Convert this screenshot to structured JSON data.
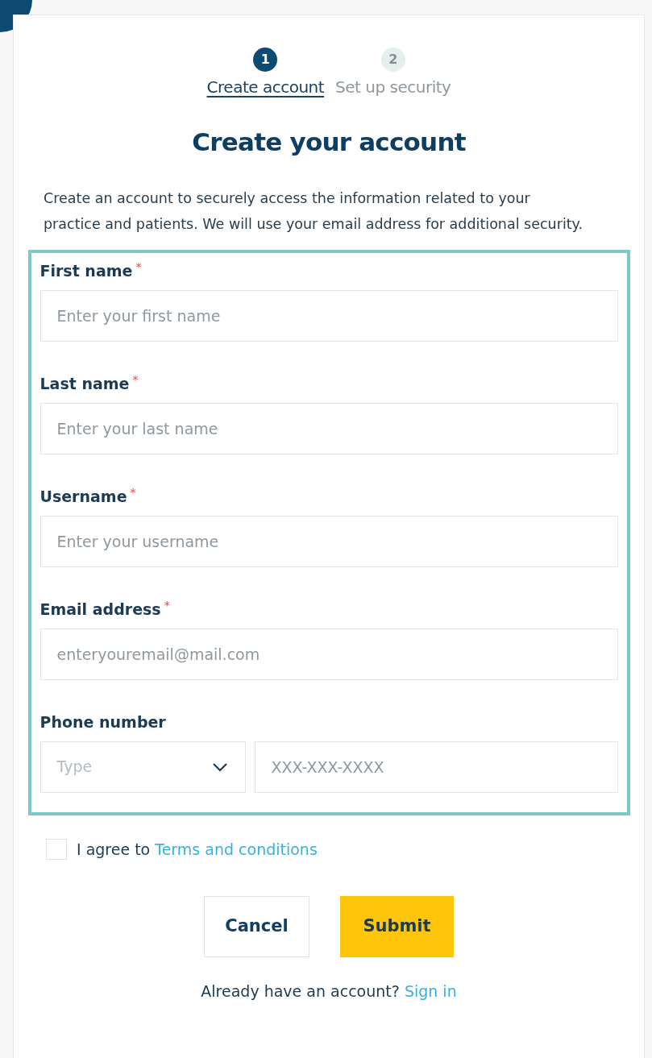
{
  "steps": [
    {
      "number": "1",
      "label": "Create account",
      "selected": true
    },
    {
      "number": "2",
      "label": "Set up security",
      "selected": false
    }
  ],
  "title": "Create your account",
  "intro": "Create an account to securely access the information related to your practice and patients.  We will use your email address for additional security.",
  "fields": [
    {
      "kind": "text",
      "label": "First name",
      "required": true,
      "placeholder": "Enter your first name"
    },
    {
      "kind": "text",
      "label": "Last name",
      "required": true,
      "placeholder": "Enter your last name"
    },
    {
      "kind": "text",
      "label": "Username",
      "required": true,
      "placeholder": "Enter your username"
    },
    {
      "kind": "text",
      "label": "Email address",
      "required": true,
      "placeholder": "enteryouremail@mail.com"
    },
    {
      "kind": "phone",
      "label": "Phone number",
      "required": false,
      "type_placeholder": "Type",
      "placeholder": "XXX-XXX-XXXX"
    }
  ],
  "required_mark": "*",
  "agree": {
    "checked": false,
    "text": "I agree to",
    "link": "Terms and conditions"
  },
  "buttons": {
    "cancel": "Cancel",
    "submit": "Submit"
  },
  "signin": {
    "text": "Already have an account?",
    "link": "Sign in"
  }
}
